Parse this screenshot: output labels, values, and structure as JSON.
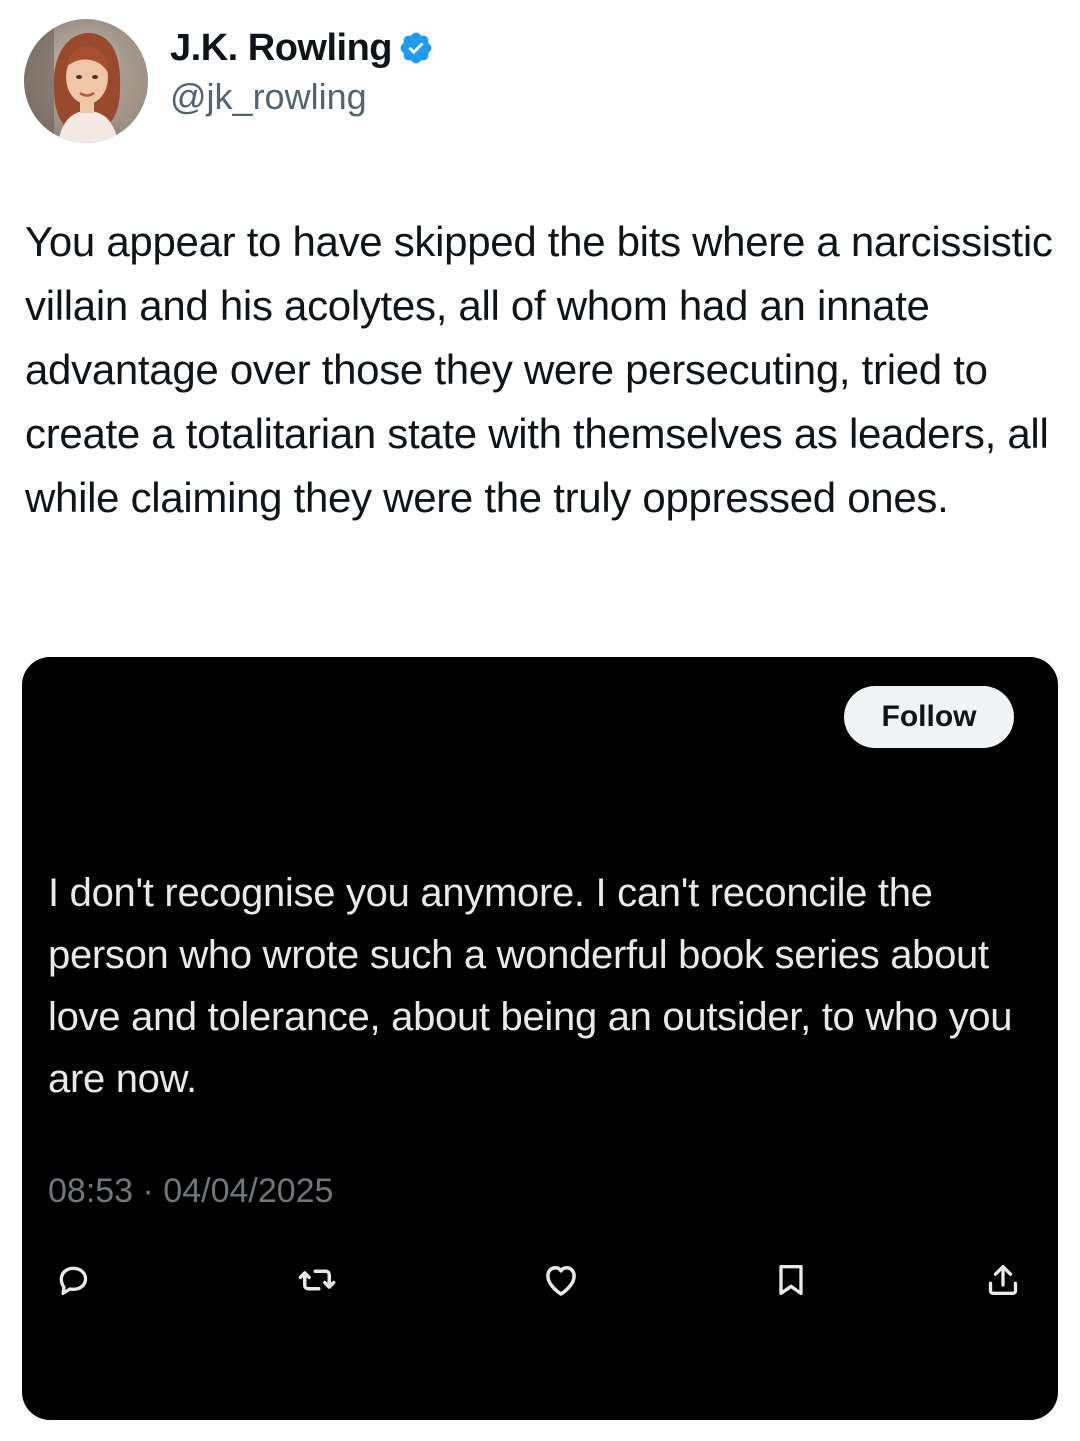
{
  "author": {
    "display_name": "J.K. Rowling",
    "handle": "@jk_rowling",
    "verified": true,
    "verified_icon": "verified-badge-icon",
    "verified_color": "#1d9bf0"
  },
  "tweet": {
    "text": "You appear to have skipped the bits where a narcissistic villain and his acolytes, all of whom had an innate advantage over those they were persecuting, tried to create a totalitarian state with themselves as leaders, all while claiming they were the truly oppressed ones."
  },
  "embedded_post": {
    "follow_label": "Follow",
    "text": "I don't recognise you anymore. I can't reconcile the person who wrote such a wonderful book series about love and tolerance, about being an outsider, to who you are now.",
    "timestamp": "08:53 · 04/04/2025",
    "actions": [
      {
        "name": "reply",
        "icon": "reply-icon"
      },
      {
        "name": "repost",
        "icon": "repost-icon"
      },
      {
        "name": "like",
        "icon": "heart-icon"
      },
      {
        "name": "bookmark",
        "icon": "bookmark-icon"
      },
      {
        "name": "share",
        "icon": "share-icon"
      }
    ]
  },
  "colors": {
    "embed_background": "#000000",
    "embed_text": "#e7e9ea",
    "muted_text": "#71767b",
    "follow_button_bg": "#eff3f4"
  }
}
